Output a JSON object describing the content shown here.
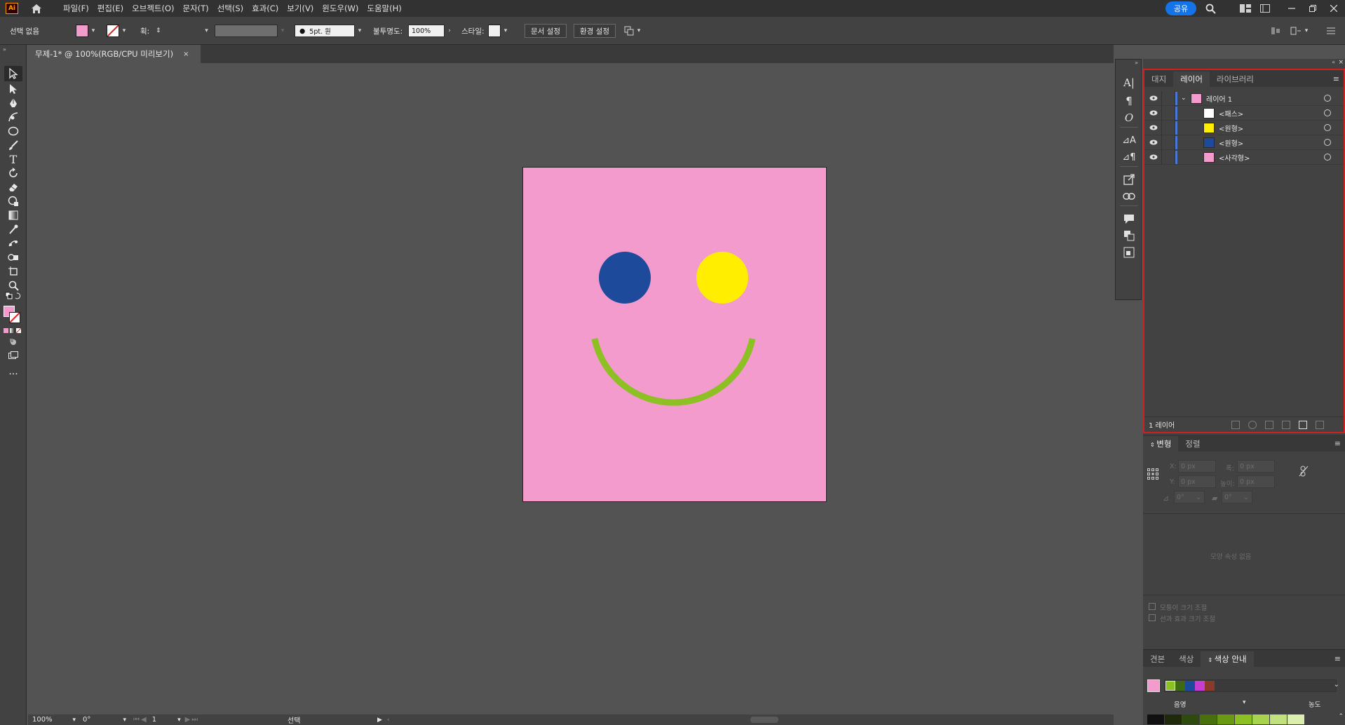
{
  "app": {
    "logo": "Ai",
    "share_label": "공유"
  },
  "menu": [
    "파일(F)",
    "편집(E)",
    "오브젝트(O)",
    "문자(T)",
    "선택(S)",
    "효과(C)",
    "보기(V)",
    "윈도우(W)",
    "도움말(H)"
  ],
  "control_bar": {
    "selection": "선택 없음",
    "stroke_label": "획:",
    "brush": "5pt. 원",
    "opacity_label": "불투명도:",
    "opacity_value": "100%",
    "style_label": "스타일:",
    "doc_setup": "문서 설정",
    "preferences": "환경 설정"
  },
  "document_tab": {
    "title": "무제-1* @ 100%(RGB/CPU 미리보기)",
    "close": "×"
  },
  "status_bar": {
    "zoom": "100%",
    "rotate": "0°",
    "artboard": "1",
    "tool": "선택"
  },
  "colors": {
    "artboard": "#f39bcc",
    "blue_eye": "#1e4a9c",
    "yellow_eye": "#ffee00",
    "smile": "#8cc023",
    "accent": "#1473e6",
    "highlight": "#d11f1f"
  },
  "layers_panel": {
    "tabs": [
      "대지",
      "레이어",
      "라이브러리"
    ],
    "active_tab": 1,
    "rows": [
      {
        "name": "레이어 1",
        "thumb": "#f39bcc",
        "level": 0
      },
      {
        "name": "<패스>",
        "thumb": "#ffffff",
        "level": 1
      },
      {
        "name": "<원형>",
        "thumb": "#ffee00",
        "level": 1
      },
      {
        "name": "<원형>",
        "thumb": "#1e4a9c",
        "level": 1
      },
      {
        "name": "<사각형>",
        "thumb": "#f39bcc",
        "level": 1
      }
    ],
    "footer": "1 레이어"
  },
  "transform_panel": {
    "tabs": [
      "변형",
      "정렬"
    ],
    "x_label": "X:",
    "y_label": "Y:",
    "w_label": "폭:",
    "h_label": "높이:",
    "x": "0 px",
    "y": "0 px",
    "w": "0 px",
    "h": "0 px",
    "angle": "0°",
    "shear": "0°",
    "no_shape": "모양 속성 없음",
    "scale_corners": "모퉁이 크기 조절",
    "scale_strokes": "선과 효과 크기 조절"
  },
  "color_guide_panel": {
    "tabs": [
      "견본",
      "색상",
      "색상 안내"
    ],
    "active_tab": 2,
    "shade_label": "음영",
    "tint_label": "농도",
    "harmony": [
      "#8cc023",
      "#3e6b12",
      "#1e4a9c",
      "#c43fd1",
      "#8b3a2a"
    ],
    "grid": [
      "#111111",
      "#1e2a0a",
      "#2f4a0e",
      "#48700f",
      "#6a9a14",
      "#8cc023",
      "#a7d34f",
      "#c1e07f",
      "#dcedb0"
    ]
  }
}
